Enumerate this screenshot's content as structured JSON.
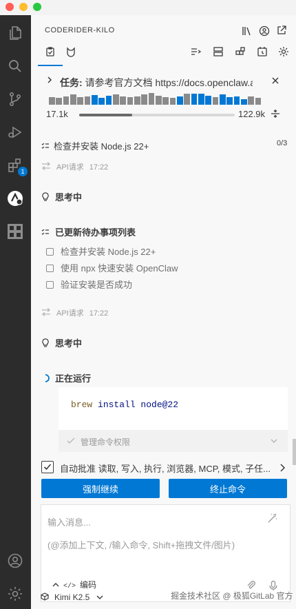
{
  "window": {
    "colors": {
      "close": "#ff5f57",
      "minimize": "#febc2e",
      "maximize": "#28c840",
      "accent": "#0078d4"
    }
  },
  "activity_bar": {
    "items": [
      {
        "icon": "files-icon"
      },
      {
        "icon": "search-icon"
      },
      {
        "icon": "source-control-icon"
      },
      {
        "icon": "run-debug-icon"
      },
      {
        "icon": "extensions-icon",
        "badge": "1"
      },
      {
        "icon": "coderider-icon"
      },
      {
        "icon": "kilo-icon"
      }
    ],
    "bottom": [
      {
        "icon": "account-icon"
      },
      {
        "icon": "settings-icon"
      }
    ]
  },
  "panel": {
    "title": "CODERIDER-KILO",
    "task": {
      "label": "任务:",
      "text": "请参考官方文档 https://docs.openclaw.ai/ ...",
      "tokens_in": "17.1k",
      "tokens_out": "122.9k",
      "context_progress": 0.34,
      "bar_heights": [
        0.55,
        0.5,
        0.6,
        0.75,
        0.55,
        0.6,
        0.7,
        0.5,
        0.65,
        0.75,
        0.6,
        0.55,
        0.6,
        0.75,
        0.85,
        0.65,
        0.55,
        0.5,
        0.6,
        0.8,
        0.8,
        0.8,
        0.65,
        0.55,
        0.75,
        0.55,
        0.6,
        0.4,
        0.6,
        0.5
      ],
      "bar_highlight": [
        false,
        false,
        false,
        false,
        false,
        false,
        true,
        true,
        true,
        false,
        false,
        false,
        false,
        false,
        false,
        false,
        false,
        false,
        true,
        false,
        true,
        true,
        true,
        false,
        true,
        true,
        true,
        true,
        false,
        false
      ]
    },
    "todo_header": {
      "text": "检查并安装 Node.js 22+",
      "count": "0/3"
    },
    "api1": {
      "label": "API请求",
      "time": "17:22"
    },
    "thinking1": "思考中",
    "todo_updated": "已更新待办事项列表",
    "todos": [
      "检查并安装 Node.js 22+",
      "使用 npx 快速安装 OpenClaw",
      "验证安装是否成功"
    ],
    "api2": {
      "label": "API请求",
      "time": "17:22"
    },
    "thinking2": "思考中",
    "running": "正在运行",
    "command": {
      "kw": "brew",
      "rest": " install node@22"
    },
    "permission": "管理命令权限",
    "auto_approve": "自动批准 读取, 写入, 执行, 浏览器, MCP, 模式, 子任...",
    "buttons": {
      "force": "强制继续",
      "stop": "终止命令"
    },
    "input": {
      "placeholder": "输入消息...",
      "hint": "(@添加上下文, /输入命令, Shift+拖拽文件/图片)",
      "mode": "编码"
    },
    "model": "Kimi K2.5",
    "watermark": "掘金技术社区 @ 极狐GitLab 官方"
  }
}
